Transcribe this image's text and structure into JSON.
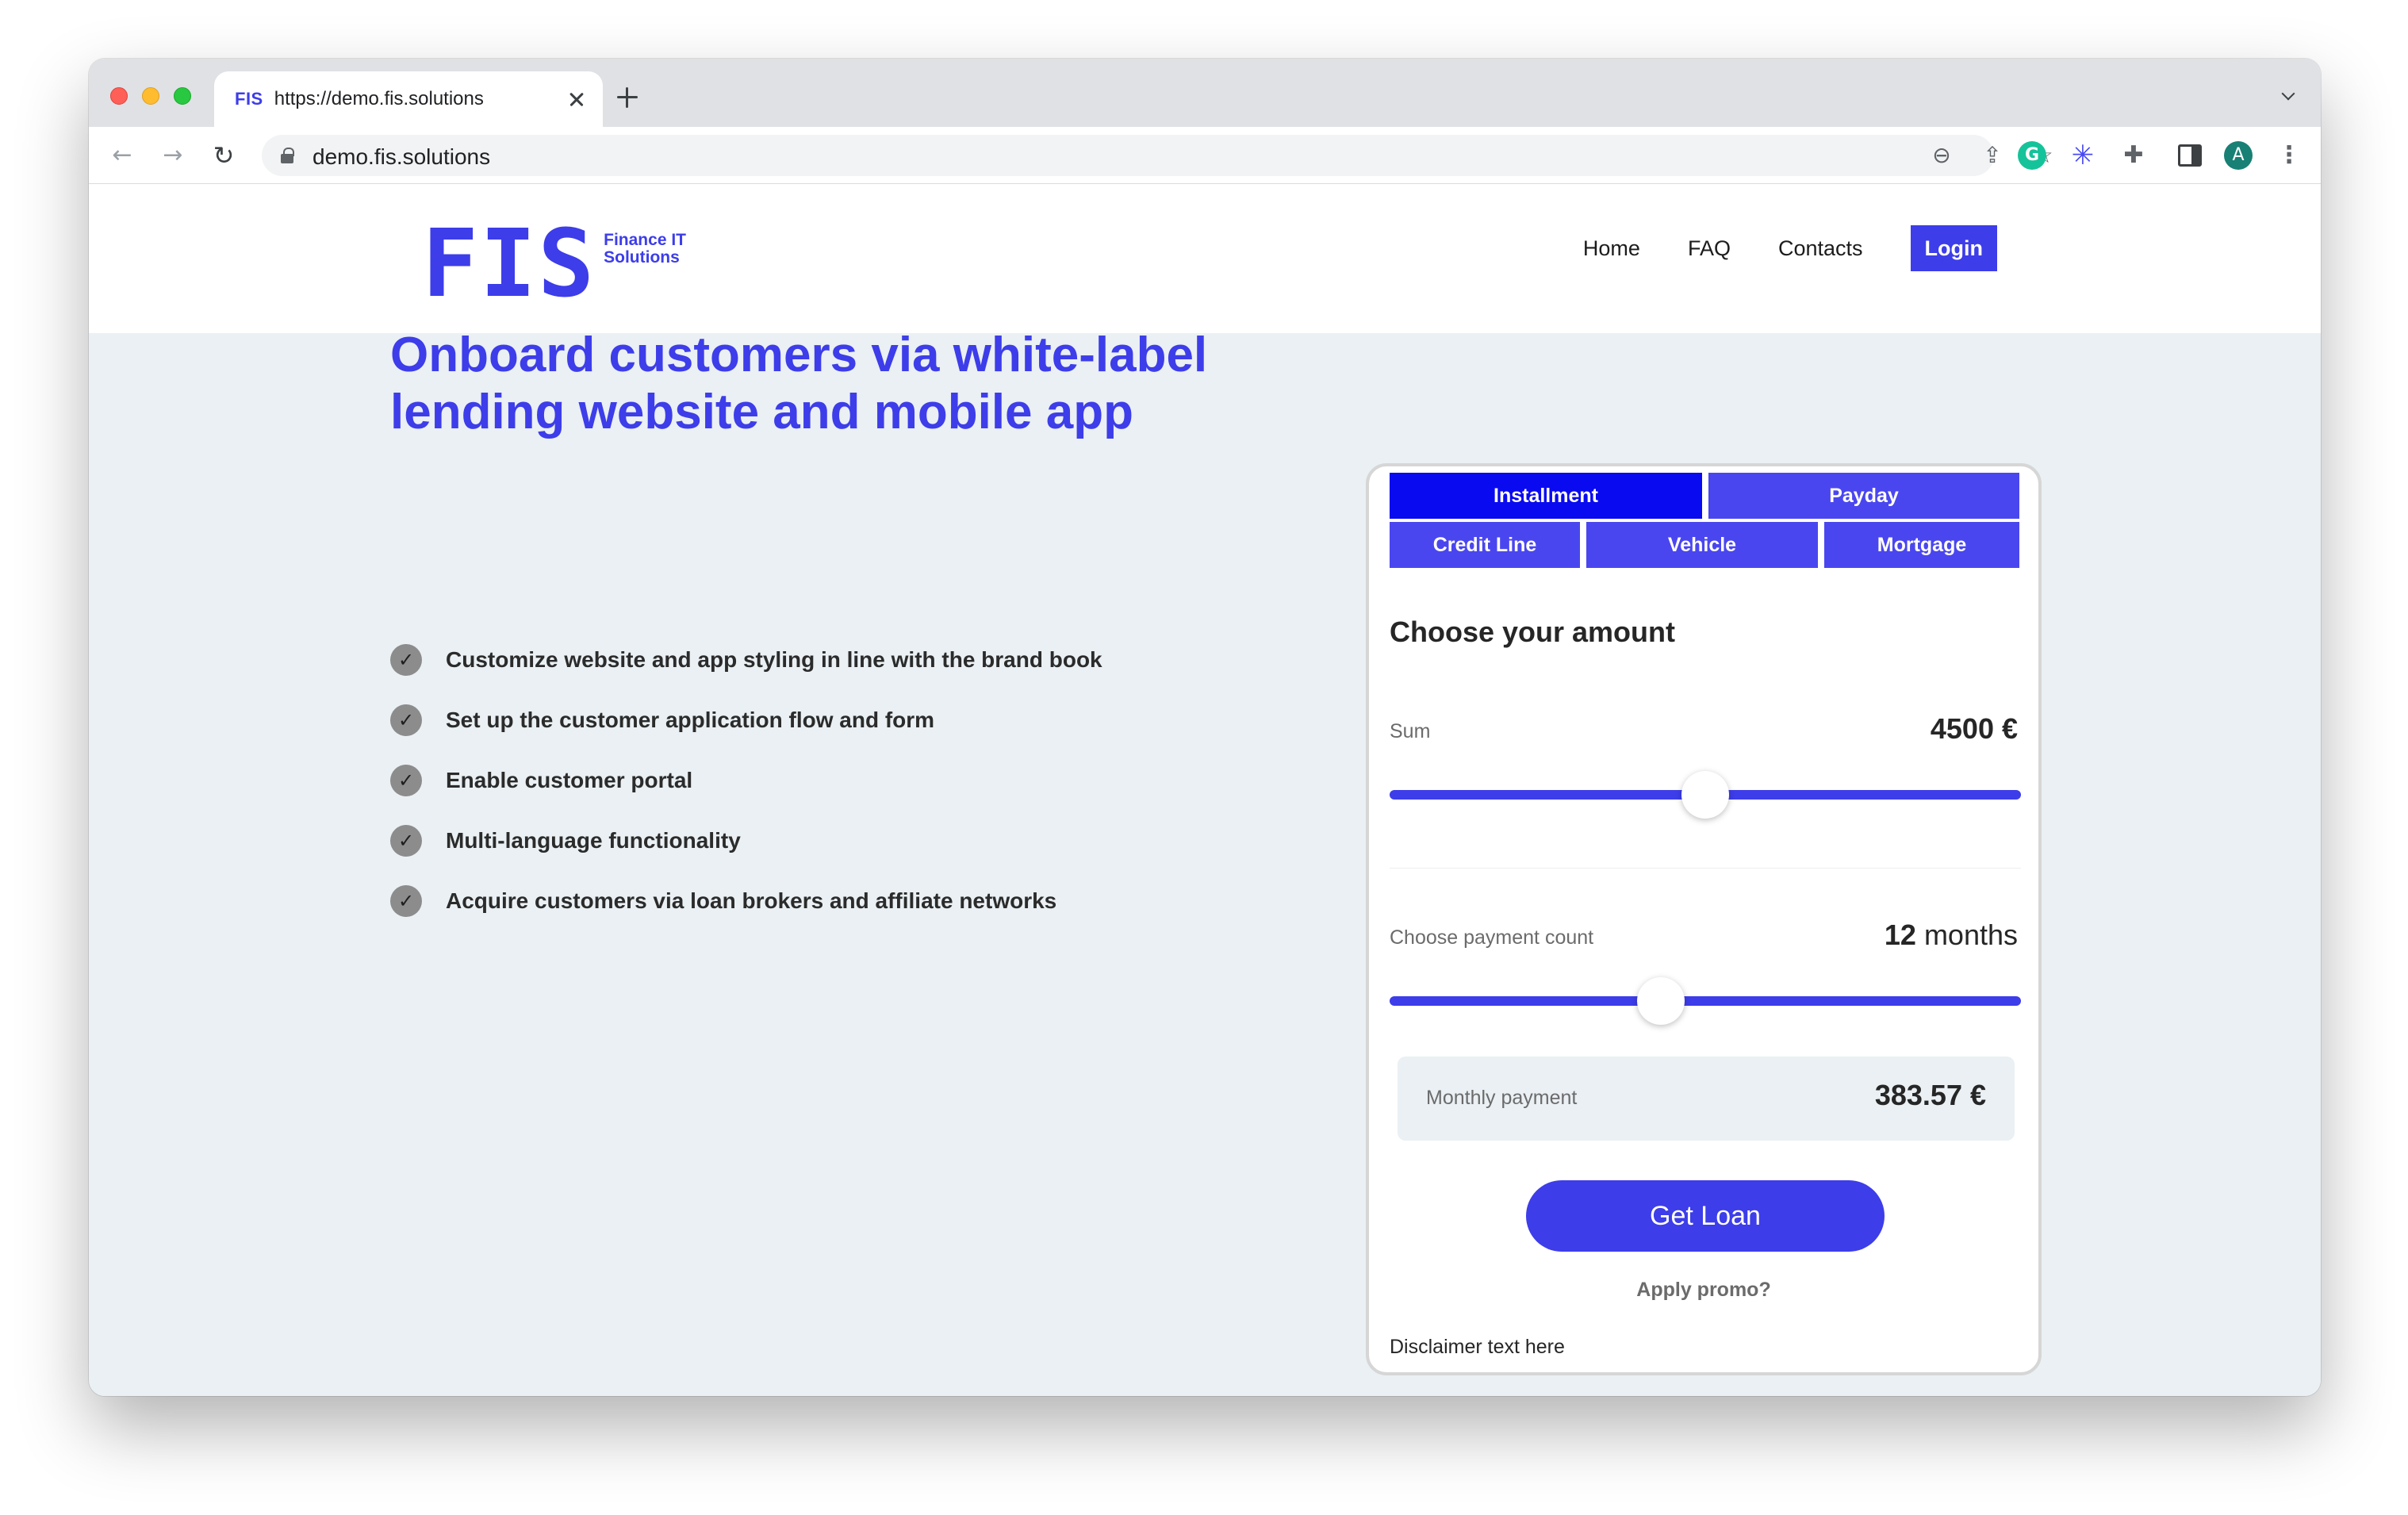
{
  "browser": {
    "tab": {
      "favicon_text": "FIS",
      "title": "https://demo.fis.solutions"
    },
    "address": {
      "url": "demo.fis.solutions"
    },
    "avatar_initial": "A"
  },
  "site": {
    "logo": {
      "mark": "FIS",
      "sub_line1": "Finance IT",
      "sub_line2": "Solutions"
    },
    "nav": {
      "home": "Home",
      "faq": "FAQ",
      "contacts": "Contacts",
      "login": "Login"
    },
    "hero_title": "Onboard customers via white-label lending website and mobile app",
    "features": [
      "Customize website and app styling in line with the brand book",
      "Set up the customer application flow and form",
      "Enable customer portal",
      "Multi-language functionality",
      "Acquire customers via loan brokers and affiliate networks"
    ]
  },
  "loan_widget": {
    "tabs": {
      "installment": "Installment",
      "payday": "Payday",
      "credit_line": "Credit Line",
      "vehicle": "Vehicle",
      "mortgage": "Mortgage"
    },
    "active_tab": "Installment",
    "title": "Choose your amount",
    "sum": {
      "label": "Sum",
      "value": "4500 €",
      "slider_fraction": 0.5
    },
    "payment_count": {
      "label": "Choose payment count",
      "number": "12",
      "unit": "months",
      "slider_fraction": 0.43
    },
    "monthly": {
      "label": "Monthly payment",
      "value": "383.57 €"
    },
    "cta": "Get Loan",
    "promo": "Apply promo?",
    "disclaimer": "Disclaimer text here"
  },
  "colors": {
    "brand": "#3d3dea",
    "active_tab": "#0a0af0",
    "page_bg": "#eaf0f3"
  }
}
